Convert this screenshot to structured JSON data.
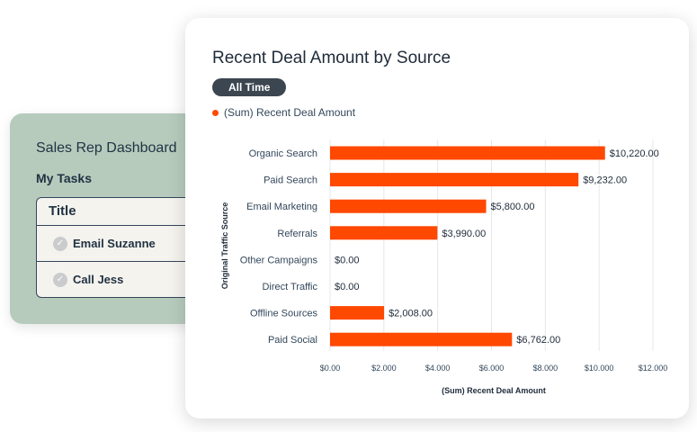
{
  "dashboard": {
    "title": "Sales Rep Dashboard",
    "subtitle": "My Tasks",
    "table_header": "Title",
    "tasks": [
      "Email Suzanne",
      "Call Jess"
    ]
  },
  "chart_card": {
    "title": "Recent Deal Amount by Source",
    "filter_label": "All Time"
  },
  "chart_data": {
    "type": "bar",
    "orientation": "horizontal",
    "categories": [
      "Organic Search",
      "Paid Search",
      "Email Marketing",
      "Referrals",
      "Other Campaigns",
      "Direct Traffic",
      "Offline Sources",
      "Paid Social"
    ],
    "series": [
      {
        "name": "(Sum) Recent Deal Amount",
        "values": [
          10220,
          9232,
          5800,
          3990,
          0,
          0,
          2008,
          6762
        ]
      }
    ],
    "data_labels": [
      "$10,220.00",
      "$9,232.00",
      "$5,800.00",
      "$3,990.00",
      "$0.00",
      "$0.00",
      "$2,008.00",
      "$6,762.00"
    ],
    "xlabel": "(Sum) Recent Deal Amount",
    "ylabel": "Original Traffic Source",
    "xlim": [
      0,
      12000
    ],
    "xticks": [
      0,
      2000,
      4000,
      6000,
      8000,
      10000,
      12000
    ],
    "xtick_labels": [
      "$0.00",
      "$2.000",
      "$4.000",
      "$6.000",
      "$8.000",
      "$10.000",
      "$12.000"
    ],
    "grid": true,
    "legend_position": "top-left",
    "bar_color": "#ff4800"
  }
}
